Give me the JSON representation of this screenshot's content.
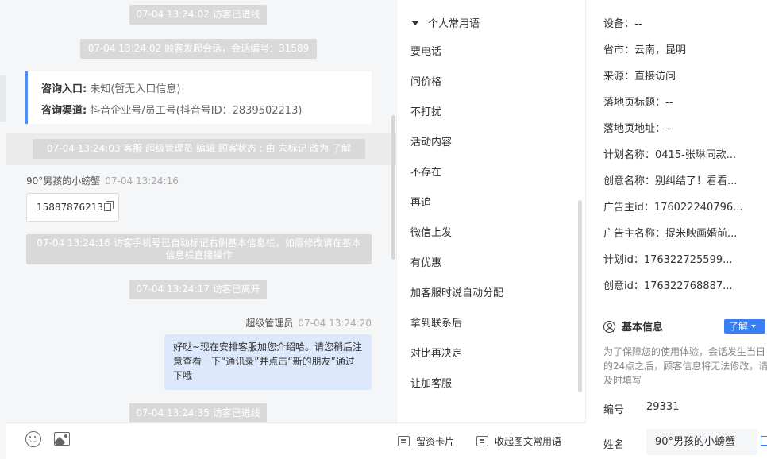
{
  "chat": {
    "sys1": "07-04 13:24:02 访客已进线",
    "sys2": "07-04 13:24:02 顾客发起会话，会话编号：31589",
    "entry": {
      "entrance_label": "咨询入口:",
      "entrance_value": "未知(暂无入口信息)",
      "channel_label": "咨询渠道:",
      "channel_value": "抖音企业号/员工号(抖音号ID：2839502213)"
    },
    "sys3": "07-04 13:24:03 客服 超级管理员 编辑 顾客状态 : 由 未标记 改为 了解",
    "visitor_name": "90°男孩的小螃蟹",
    "visitor_time": "07-04 13:24:16",
    "visitor_phone": "15887876213",
    "sys4": "07-04 13:24:16 访客手机号已自动标记右侧基本信息栏，如需修改请在基本信息栏直接操作",
    "sys5": "07-04 13:24:17 访客已离开",
    "agent_name": "超级管理员",
    "agent_time": "07-04 13:24:20",
    "agent_message": "好哒~现在安排客服加您介绍哈。请您稍后注意查看一下“通讯录”并点击“新的朋友”通过下哦",
    "sys6": "07-04 13:24:35 访客已进线"
  },
  "toolbar": {
    "emoji_icon": "emoji-icon",
    "image_icon": "image-icon",
    "leave_card": "留资卡片",
    "collect_phrases": "收起图文常用语"
  },
  "phrases": {
    "header": "个人常用语",
    "items": [
      "要电话",
      "问价格",
      "不打扰",
      "活动内容",
      "不存在",
      "再追",
      "微信上发",
      "有优惠",
      "加客服时说自动分配",
      "拿到联系后",
      "对比再决定",
      "让加客服"
    ]
  },
  "info": {
    "rows": [
      "设备：--",
      "省市：云南，昆明",
      "来源：直接访问",
      "落地页标题：--",
      "落地页地址：--",
      "计划名称：0415-张琳同款...",
      "创意名称：别纠结了！看看...",
      "广告主id：176022240796...",
      "广告主名称：提米映画婚前...",
      "计划id：176322725599...",
      "创意id：176322768887..."
    ],
    "section_title": "基本信息",
    "learn_label": "了解",
    "notice": "为了保障您的使用体验，会话发生当日的24点之后，顾客信息将无法修改，请及时填写",
    "number_label": "编号",
    "number_value": "29331",
    "name_label": "姓名",
    "name_value": "90°男孩的小螃蟹"
  },
  "colors": {
    "accent": "#3a7ef4",
    "agent_bubble": "#dce8fc",
    "system_pill": "#d9d9d9"
  }
}
